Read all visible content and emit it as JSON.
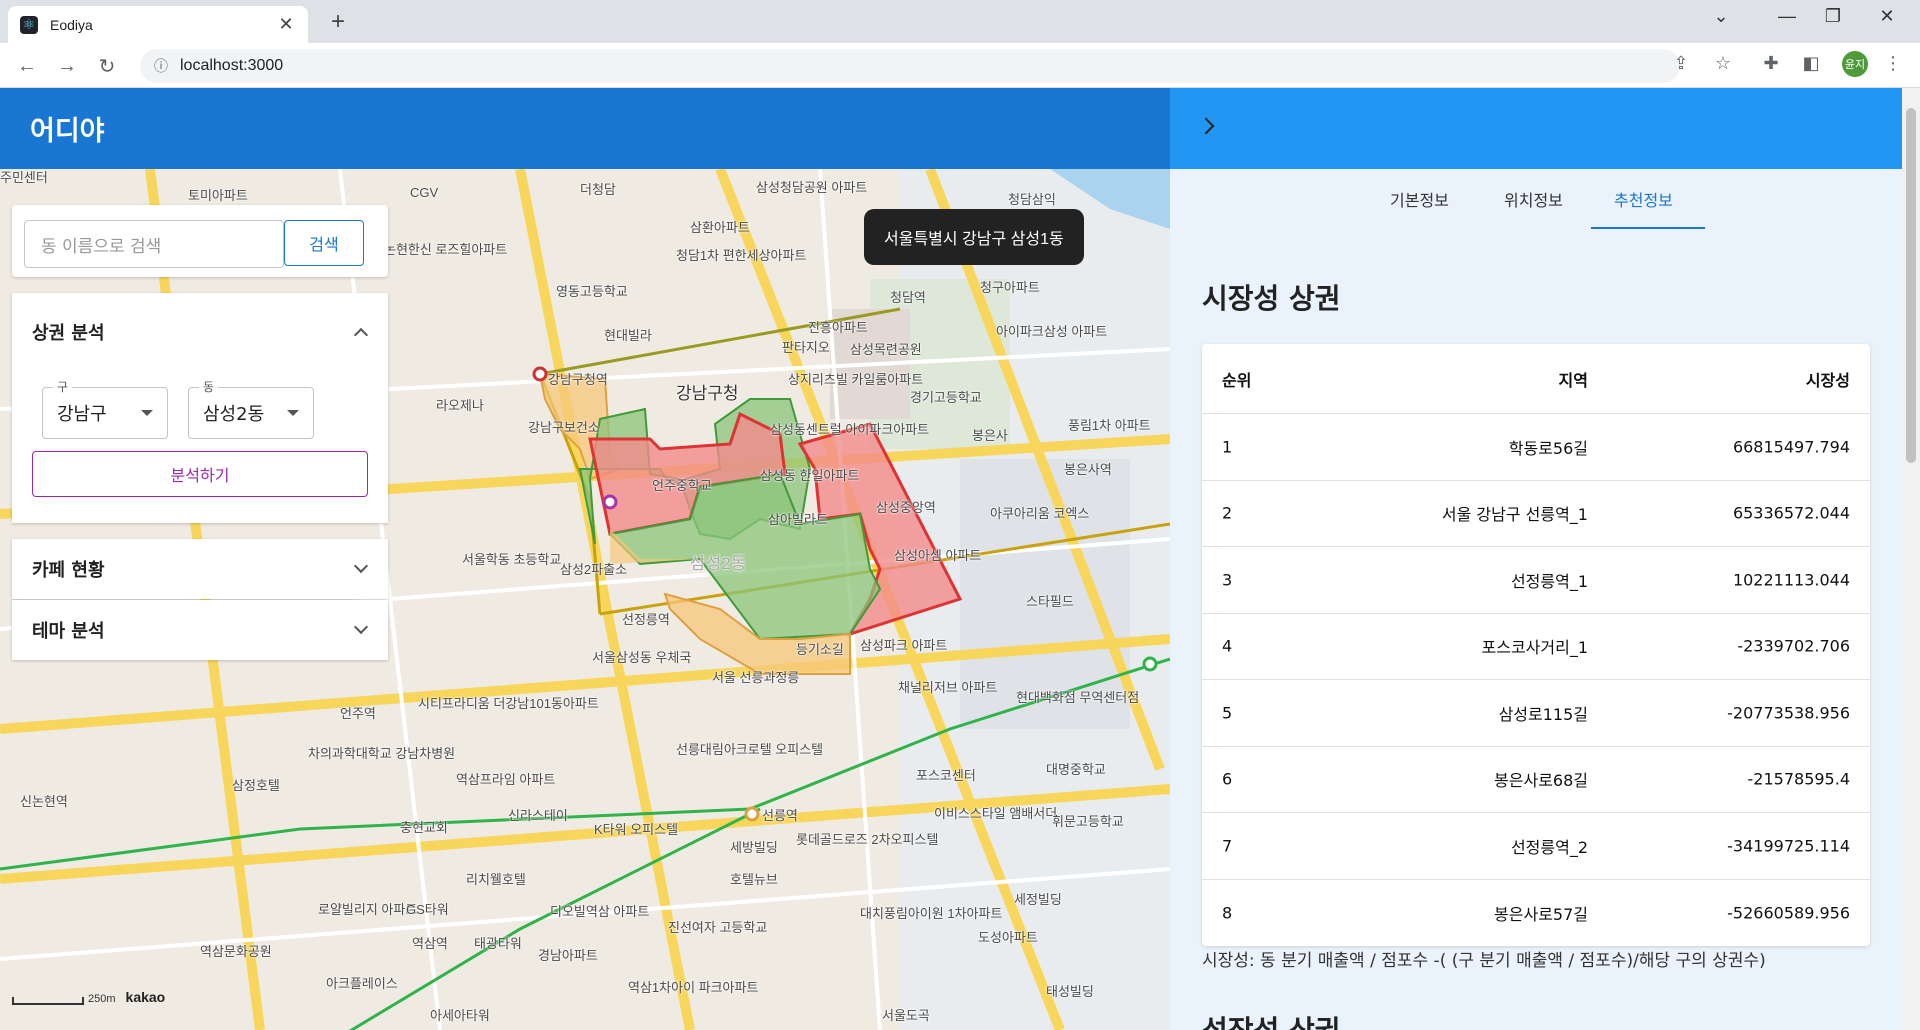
{
  "browser": {
    "tab_title": "Eodiya",
    "url": "localhost:3000",
    "profile_initials": "윤지"
  },
  "app": {
    "brand": "어디야"
  },
  "search": {
    "placeholder": "동 이름으로 검색",
    "button_label": "검색"
  },
  "accordions": {
    "commercial": {
      "title": "상권 분석",
      "gu_label": "구",
      "gu_value": "강남구",
      "dong_label": "동",
      "dong_value": "삼성2동",
      "analyze_label": "분석하기"
    },
    "cafe": {
      "title": "카페 현황"
    },
    "theme": {
      "title": "테마 분석"
    }
  },
  "map": {
    "tooltip": "서울특별시 강남구 삼성1동",
    "scale_label": "250m",
    "provider": "kakao",
    "labels": [
      "주민센터",
      "토미아파트",
      "CGV",
      "더청담",
      "삼성청담공원 아파트",
      "청담삼익",
      "삼환아파트",
      "청담1차 편한세상아파트",
      "논현한신 로즈힐아파트",
      "영동고등학교",
      "청담역",
      "청구아파트",
      "현대빌라",
      "진흥아파트",
      "아이파크삼성 아파트",
      "판타지오",
      "삼성목련공원",
      "강남구청역",
      "강남구청",
      "상지리츠빌 카일룸아파트",
      "경기고등학교",
      "라오제나",
      "강남구보건소",
      "삼성동센트럴 아이파크아파트",
      "봉은사",
      "풍림1차 아파트",
      "봉은사역",
      "언주중학교",
      "삼성동 한일아파트",
      "삼아빌라트",
      "삼성중앙역",
      "아쿠아리움 코엑스",
      "삼성아셈 아파트",
      "서울학동 초등학교",
      "삼성2파출소",
      "삼성2동",
      "스타필드",
      "선정릉역",
      "등기소길",
      "삼성파크 아파트",
      "서울삼성동 우체국",
      "서울 선릉과정릉",
      "채널리저브 아파트",
      "현대백화점 무역센터점",
      "시티프라디움 더강남101동아파트",
      "언주역",
      "차의과학대학교 강남차병원",
      "선릉대림아크로텔 오피스텔",
      "삼정호텔",
      "포스코센터",
      "대명중학교",
      "신논현역",
      "역삼프라임 아파트",
      "신라스테이",
      "선릉역",
      "이비스스타일 앰배서더",
      "휘문고등학교",
      "충현교회",
      "K타워 오피스텔",
      "롯데골드로즈 2차오피스텔",
      "세방빌딩",
      "호텔뉴브",
      "리치웰호텔",
      "로얄빌리지 아파트",
      "GS타워",
      "디오빌역삼 아파트",
      "진선여자 고등학교",
      "대치풍림아이원 1차아파트",
      "세정빌딩",
      "역삼역",
      "태광타워",
      "경남아파트",
      "도성아파트",
      "역삼문화공원",
      "아크플레이스",
      "역삼1차아이 파크아파트",
      "아세아타워",
      "태성빌딩",
      "서울도곡"
    ]
  },
  "right_panel": {
    "tabs": [
      "기본정보",
      "위치정보",
      "추천정보"
    ],
    "active_tab": "추천정보",
    "section_title": "시장성 상권",
    "table": {
      "headers": [
        "순위",
        "지역",
        "시장성"
      ],
      "rows": [
        [
          "1",
          "학동로56길",
          "66815497.794"
        ],
        [
          "2",
          "서울 강남구 선릉역_1",
          "65336572.044"
        ],
        [
          "3",
          "선정릉역_1",
          "10221113.044"
        ],
        [
          "4",
          "포스코사거리_1",
          "-2339702.706"
        ],
        [
          "5",
          "삼성로115길",
          "-20773538.956"
        ],
        [
          "6",
          "봉은사로68길",
          "-21578595.4"
        ],
        [
          "7",
          "선정릉역_2",
          "-34199725.114"
        ],
        [
          "8",
          "봉은사로57길",
          "-52660589.956"
        ]
      ]
    },
    "footnote": "시장성: 동 분기 매출액 / 점포수 -( (구 분기 매출액 / 점포수)/해당 구의 상권수)",
    "next_section_title": "성장성 상권"
  },
  "colors": {
    "app_bar": "#1976d2",
    "right_header": "#2196f3",
    "district_red": "#f28b8b",
    "district_green": "#8bc47a",
    "district_orange": "#f7c77a"
  }
}
